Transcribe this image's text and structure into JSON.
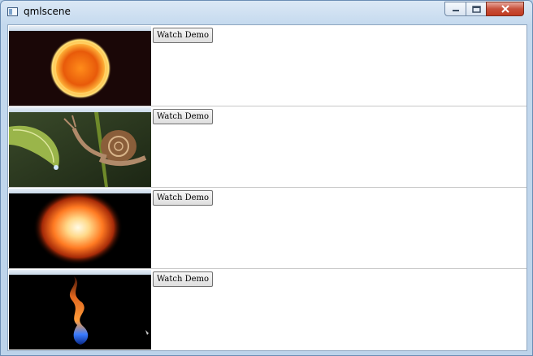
{
  "window": {
    "title": "qmlscene",
    "controls": {
      "minimize": "minimize",
      "maximize": "maximize",
      "close": "close"
    }
  },
  "rows": [
    {
      "thumbnail": "fire-ring",
      "button_label": "Watch Demo"
    },
    {
      "thumbnail": "snail-and-leaf",
      "button_label": "Watch Demo"
    },
    {
      "thumbnail": "explosion",
      "button_label": "Watch Demo"
    },
    {
      "thumbnail": "flame-column",
      "button_label": "Watch Demo"
    }
  ],
  "colors": {
    "titlebar": "#c4d9ee",
    "close": "#c7503b",
    "row_divider": "#c8c8c8"
  }
}
